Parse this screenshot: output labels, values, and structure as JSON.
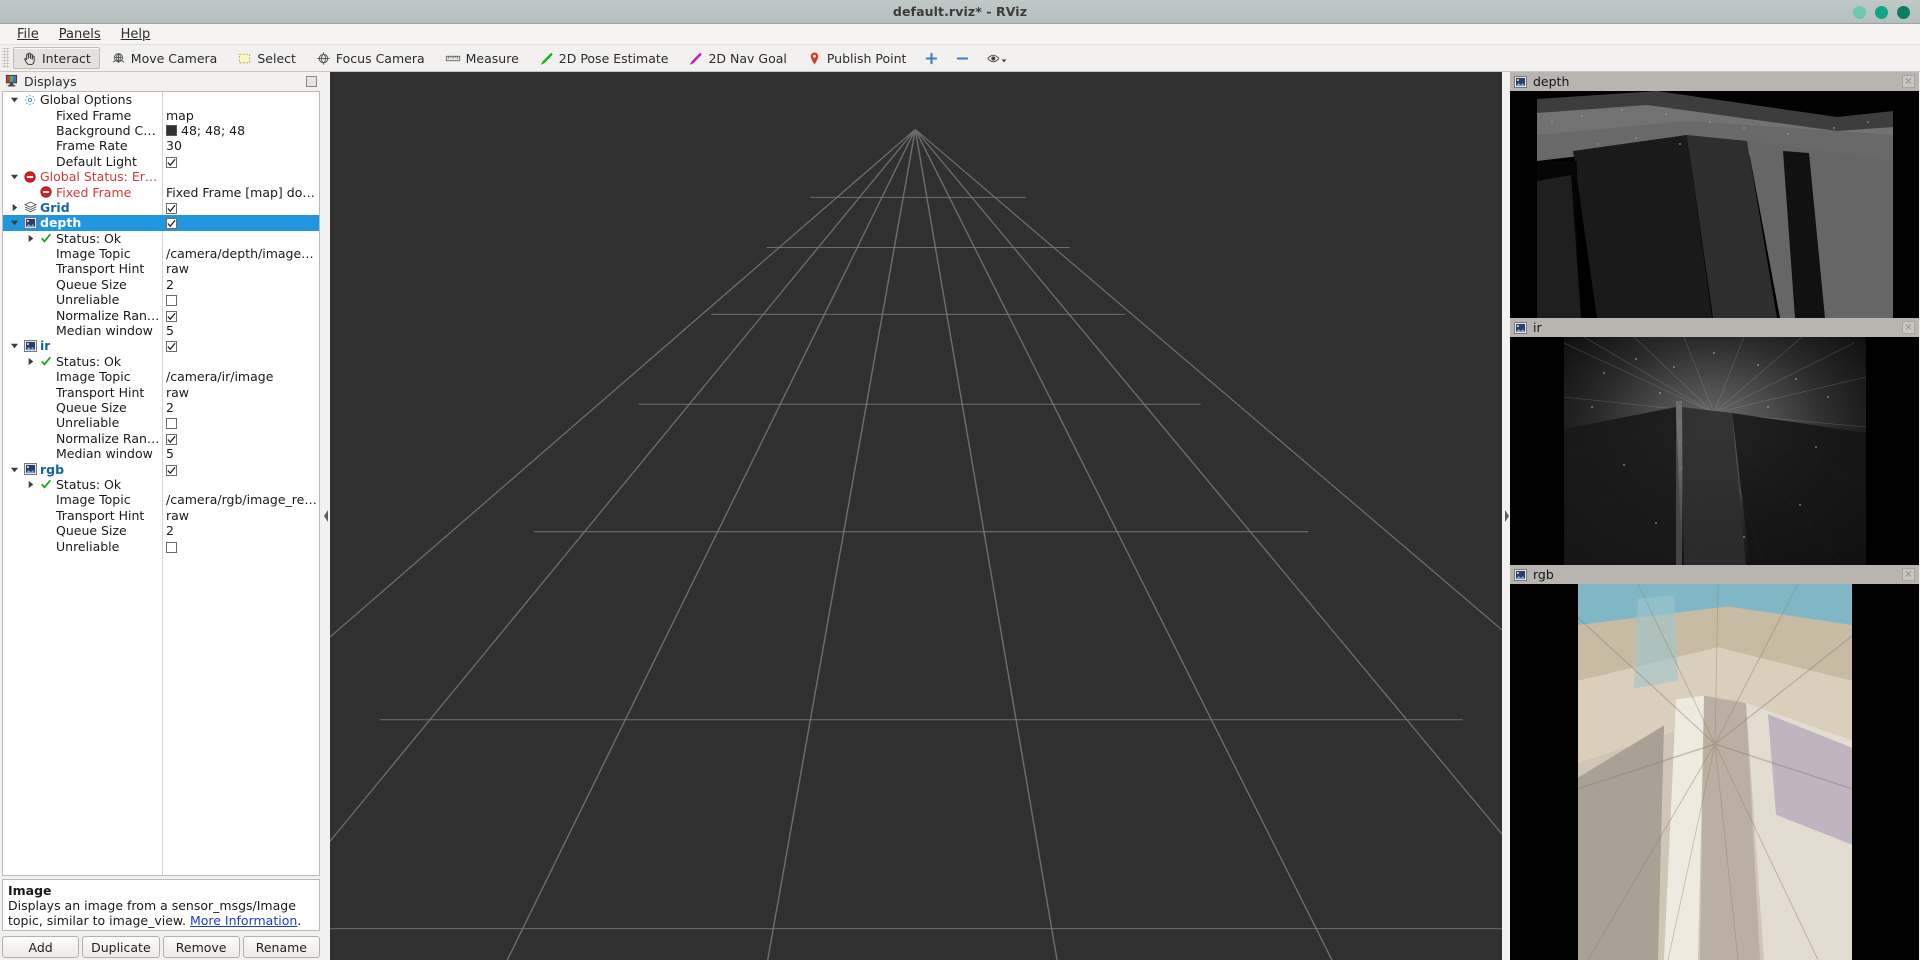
{
  "window": {
    "title": "default.rviz* - RViz",
    "buttons": [
      "minimize",
      "maximize",
      "close"
    ],
    "button_colors": [
      "#6ec8b0",
      "#10a588",
      "#0b7d62"
    ]
  },
  "menu": {
    "items": [
      {
        "label": "File",
        "mnemonic": "F"
      },
      {
        "label": "Panels",
        "mnemonic": "P"
      },
      {
        "label": "Help",
        "mnemonic": "H"
      }
    ]
  },
  "toolbar": {
    "items": [
      {
        "label": "Interact",
        "icon": "hand-cursor-icon",
        "active": true
      },
      {
        "label": "Move Camera",
        "icon": "move-camera-icon",
        "active": false
      },
      {
        "label": "Select",
        "icon": "select-rect-icon",
        "active": false
      },
      {
        "label": "Focus Camera",
        "icon": "focus-camera-icon",
        "active": false
      },
      {
        "label": "Measure",
        "icon": "ruler-icon",
        "active": false
      },
      {
        "label": "2D Pose Estimate",
        "icon": "green-arrow-icon",
        "active": false
      },
      {
        "label": "2D Nav Goal",
        "icon": "magenta-arrow-icon",
        "active": false
      },
      {
        "label": "Publish Point",
        "icon": "map-pin-icon",
        "active": false
      },
      {
        "label": "",
        "icon": "plus-icon",
        "active": false
      },
      {
        "label": "",
        "icon": "minus-icon",
        "active": false
      },
      {
        "label": "",
        "icon": "eye-dropdown-icon",
        "active": false
      }
    ]
  },
  "displays": {
    "header": {
      "title": "Displays",
      "icon": "displays-icon"
    },
    "rows": [
      {
        "indent": 0,
        "arrow": "down",
        "icon": "gear-icon",
        "name": "Global Options",
        "style": "plain",
        "value_type": "none",
        "value": ""
      },
      {
        "indent": 1,
        "arrow": "none",
        "icon": "none",
        "name": "Fixed Frame",
        "style": "plain",
        "value_type": "text",
        "value": "map"
      },
      {
        "indent": 1,
        "arrow": "none",
        "icon": "none",
        "name": "Background Color",
        "style": "plain",
        "value_type": "color",
        "value": "48; 48; 48",
        "color": "#303030"
      },
      {
        "indent": 1,
        "arrow": "none",
        "icon": "none",
        "name": "Frame Rate",
        "style": "plain",
        "value_type": "text",
        "value": "30"
      },
      {
        "indent": 1,
        "arrow": "none",
        "icon": "none",
        "name": "Default Light",
        "style": "plain",
        "value_type": "checked",
        "value": ""
      },
      {
        "indent": 0,
        "arrow": "down",
        "icon": "error-icon",
        "name": "Global Status: Error",
        "style": "red",
        "value_type": "none",
        "value": ""
      },
      {
        "indent": 1,
        "arrow": "none",
        "icon": "error-icon",
        "name": "Fixed Frame",
        "style": "red",
        "value_type": "text",
        "value": "Fixed Frame [map] does n…"
      },
      {
        "indent": 0,
        "arrow": "right",
        "icon": "grid-icon",
        "name": "Grid",
        "style": "blue",
        "value_type": "checked",
        "value": ""
      },
      {
        "indent": 0,
        "arrow": "down",
        "icon": "image-icon",
        "name": "depth",
        "style": "blue",
        "value_type": "checked",
        "value": "",
        "selected": true
      },
      {
        "indent": 1,
        "arrow": "right",
        "icon": "ok-icon",
        "name": "Status: Ok",
        "style": "plain",
        "value_type": "none",
        "value": ""
      },
      {
        "indent": 1,
        "arrow": "none",
        "icon": "none",
        "name": "Image Topic",
        "style": "plain",
        "value_type": "text",
        "value": "/camera/depth/image_raw"
      },
      {
        "indent": 1,
        "arrow": "none",
        "icon": "none",
        "name": "Transport Hint",
        "style": "plain",
        "value_type": "text",
        "value": "raw"
      },
      {
        "indent": 1,
        "arrow": "none",
        "icon": "none",
        "name": "Queue Size",
        "style": "plain",
        "value_type": "text",
        "value": "2"
      },
      {
        "indent": 1,
        "arrow": "none",
        "icon": "none",
        "name": "Unreliable",
        "style": "plain",
        "value_type": "unchecked",
        "value": ""
      },
      {
        "indent": 1,
        "arrow": "none",
        "icon": "none",
        "name": "Normalize Range",
        "style": "plain",
        "value_type": "checked",
        "value": ""
      },
      {
        "indent": 1,
        "arrow": "none",
        "icon": "none",
        "name": "Median window",
        "style": "plain",
        "value_type": "text",
        "value": "5"
      },
      {
        "indent": 0,
        "arrow": "down",
        "icon": "image-icon",
        "name": "ir",
        "style": "blue",
        "value_type": "checked",
        "value": ""
      },
      {
        "indent": 1,
        "arrow": "right",
        "icon": "ok-icon",
        "name": "Status: Ok",
        "style": "plain",
        "value_type": "none",
        "value": ""
      },
      {
        "indent": 1,
        "arrow": "none",
        "icon": "none",
        "name": "Image Topic",
        "style": "plain",
        "value_type": "text",
        "value": "/camera/ir/image"
      },
      {
        "indent": 1,
        "arrow": "none",
        "icon": "none",
        "name": "Transport Hint",
        "style": "plain",
        "value_type": "text",
        "value": "raw"
      },
      {
        "indent": 1,
        "arrow": "none",
        "icon": "none",
        "name": "Queue Size",
        "style": "plain",
        "value_type": "text",
        "value": "2"
      },
      {
        "indent": 1,
        "arrow": "none",
        "icon": "none",
        "name": "Unreliable",
        "style": "plain",
        "value_type": "unchecked",
        "value": ""
      },
      {
        "indent": 1,
        "arrow": "none",
        "icon": "none",
        "name": "Normalize Range",
        "style": "plain",
        "value_type": "checked",
        "value": ""
      },
      {
        "indent": 1,
        "arrow": "none",
        "icon": "none",
        "name": "Median window",
        "style": "plain",
        "value_type": "text",
        "value": "5"
      },
      {
        "indent": 0,
        "arrow": "down",
        "icon": "image-icon",
        "name": "rgb",
        "style": "blue",
        "value_type": "checked",
        "value": ""
      },
      {
        "indent": 1,
        "arrow": "right",
        "icon": "ok-icon",
        "name": "Status: Ok",
        "style": "plain",
        "value_type": "none",
        "value": ""
      },
      {
        "indent": 1,
        "arrow": "none",
        "icon": "none",
        "name": "Image Topic",
        "style": "plain",
        "value_type": "text",
        "value": "/camera/rgb/image_rect…"
      },
      {
        "indent": 1,
        "arrow": "none",
        "icon": "none",
        "name": "Transport Hint",
        "style": "plain",
        "value_type": "text",
        "value": "raw"
      },
      {
        "indent": 1,
        "arrow": "none",
        "icon": "none",
        "name": "Queue Size",
        "style": "plain",
        "value_type": "text",
        "value": "2"
      },
      {
        "indent": 1,
        "arrow": "none",
        "icon": "none",
        "name": "Unreliable",
        "style": "plain",
        "value_type": "unchecked",
        "value": ""
      }
    ],
    "description": {
      "title": "Image",
      "text_before": "Displays an image from a sensor_msgs/Image topic, similar to image_view. ",
      "link": "More Information",
      "text_after": "."
    },
    "buttons": [
      {
        "label": "Add"
      },
      {
        "label": "Duplicate"
      },
      {
        "label": "Remove"
      },
      {
        "label": "Rename"
      }
    ]
  },
  "image_panels": [
    {
      "title": "depth",
      "icon": "image-icon",
      "close": "×"
    },
    {
      "title": "ir",
      "icon": "image-icon",
      "close": "×"
    },
    {
      "title": "rgb",
      "icon": "image-icon",
      "close": "×"
    }
  ],
  "view3d": {
    "background_color": "#303030",
    "grid_color": "#7d7d7d"
  }
}
